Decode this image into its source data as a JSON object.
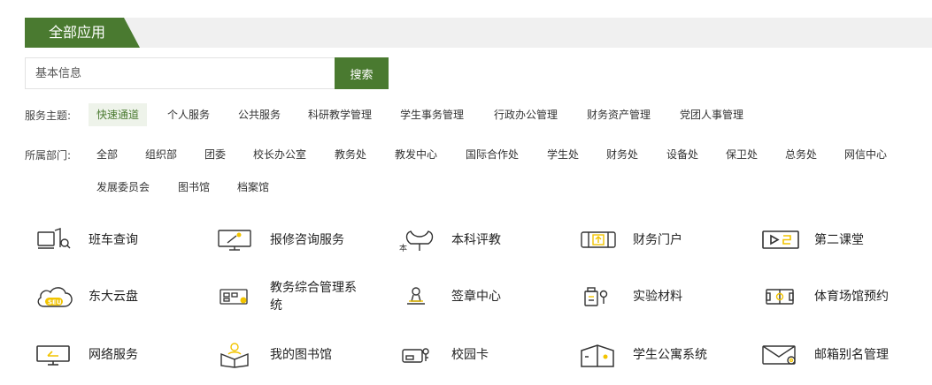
{
  "header": {
    "title": "全部应用"
  },
  "search": {
    "placeholder": "基本信息",
    "button_label": "搜索"
  },
  "themes": {
    "label": "服务主题:",
    "items": [
      "快速通道",
      "个人服务",
      "公共服务",
      "科研教学管理",
      "学生事务管理",
      "行政办公管理",
      "财务资产管理",
      "党团人事管理"
    ],
    "active_index": 0
  },
  "departments": {
    "label": "所属部门:",
    "items": [
      "全部",
      "组织部",
      "团委",
      "校长办公室",
      "教务处",
      "教发中心",
      "国际合作处",
      "学生处",
      "财务处",
      "设备处",
      "保卫处",
      "总务处",
      "网信中心",
      "发展委员会",
      "图书馆",
      "档案馆"
    ]
  },
  "apps": [
    {
      "name": "班车查询",
      "icon": "shuttle-bus-icon"
    },
    {
      "name": "报修咨询服务",
      "icon": "repair-monitor-icon"
    },
    {
      "name": "本科评教",
      "icon": "flower-evaluation-icon"
    },
    {
      "name": "财务门户",
      "icon": "finance-book-icon"
    },
    {
      "name": "第二课堂",
      "icon": "play-classroom-icon"
    },
    {
      "name": "东大云盘",
      "icon": "seu-cloud-icon"
    },
    {
      "name": "教务综合管理系统",
      "icon": "academic-system-icon"
    },
    {
      "name": "签章中心",
      "icon": "signature-stamp-icon"
    },
    {
      "name": "实验材料",
      "icon": "lab-material-icon"
    },
    {
      "name": "体育场馆预约",
      "icon": "stadium-booking-icon"
    },
    {
      "name": "网络服务",
      "icon": "network-monitor-icon"
    },
    {
      "name": "我的图书馆",
      "icon": "library-person-icon"
    },
    {
      "name": "校园卡",
      "icon": "campus-card-icon"
    },
    {
      "name": "学生公寓系统",
      "icon": "dormitory-icon"
    },
    {
      "name": "邮箱别名管理",
      "icon": "mail-settings-icon"
    }
  ],
  "colors": {
    "accent": "#4a7a30",
    "header_bg": "#f0f0f0",
    "chip_active_bg": "#eef3ea",
    "icon_stroke": "#333333",
    "icon_yellow": "#f2c400"
  }
}
